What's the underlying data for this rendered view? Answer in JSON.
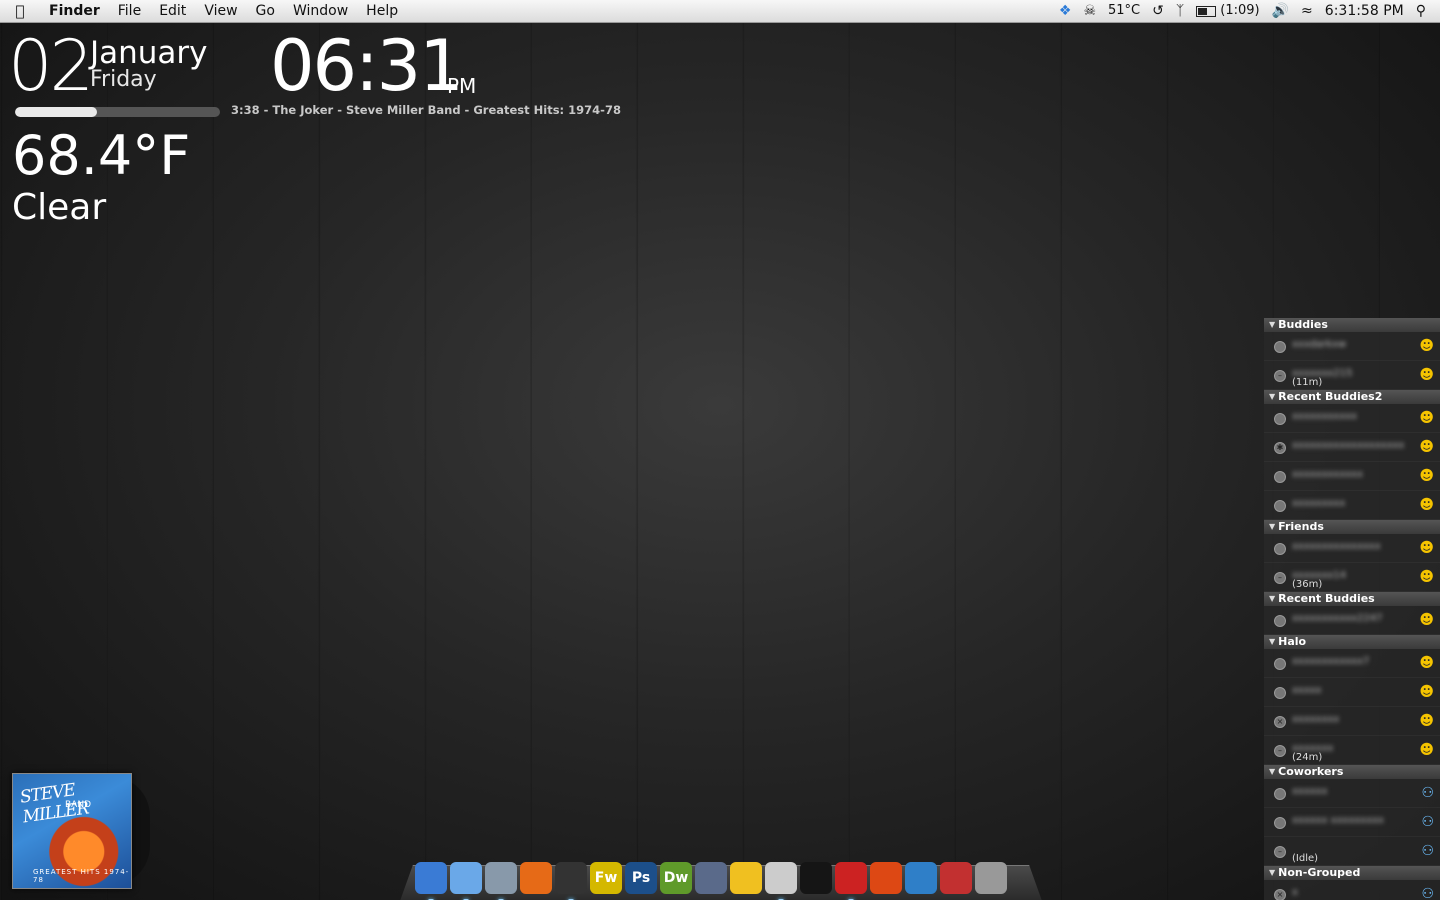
{
  "menubar": {
    "apple_icon": "apple-icon",
    "menus": [
      "Finder",
      "File",
      "Edit",
      "View",
      "Go",
      "Window",
      "Help"
    ],
    "status": {
      "temperature": "51°C",
      "battery": "(1:09)",
      "clock": "6:31:58 PM"
    }
  },
  "widgets": {
    "date_day": "02",
    "month": "January",
    "weekday": "Friday",
    "time": "06:31",
    "ampm": "PM",
    "track": "3:38 - The Joker - Steve Miller Band - Greatest Hits: 1974-78",
    "track_progress": 0.4,
    "temperature": "68.4°F",
    "condition": "Clear"
  },
  "album": {
    "title": "STEVE MILLER",
    "subtitle": "BAND",
    "bottom": "GREATEST HITS 1974-78"
  },
  "dock": {
    "apps": [
      {
        "icon": "finder-icon",
        "label": "",
        "color": "#3a7bd5",
        "running": true
      },
      {
        "icon": "itunes-icon",
        "label": "",
        "color": "#6aa8e8",
        "running": true
      },
      {
        "icon": "mail-icon",
        "label": "",
        "color": "#8899aa",
        "running": true
      },
      {
        "icon": "firefox-icon",
        "label": "",
        "color": "#e66a17",
        "running": false
      },
      {
        "icon": "adium-icon",
        "label": "",
        "color": "#333333",
        "running": true
      },
      {
        "icon": "fireworks-icon",
        "label": "Fw",
        "color": "#d4b800",
        "running": false
      },
      {
        "icon": "photoshop-icon",
        "label": "Ps",
        "color": "#1c4f8a",
        "running": false
      },
      {
        "icon": "dreamweaver-icon",
        "label": "Dw",
        "color": "#5f9a2a",
        "running": false
      },
      {
        "icon": "xcode-icon",
        "label": "",
        "color": "#5a6a8a",
        "running": false
      },
      {
        "icon": "cyberduck-icon",
        "label": "",
        "color": "#f0c020",
        "running": false
      },
      {
        "icon": "cd-icon",
        "label": "",
        "color": "#cccccc",
        "running": true
      },
      {
        "icon": "terminal-icon",
        "label": "",
        "color": "#151515",
        "running": false
      },
      {
        "icon": "parallels-icon",
        "label": "",
        "color": "#cc2222",
        "running": true
      },
      {
        "icon": "ubuntu-icon",
        "label": "",
        "color": "#dd4814",
        "running": false
      },
      {
        "icon": "windows-icon",
        "label": "",
        "color": "#2f7fc8",
        "running": false
      },
      {
        "icon": "app-store-icon",
        "label": "",
        "color": "#c23030",
        "running": false
      },
      {
        "icon": "trash-icon",
        "label": "",
        "color": "#999999",
        "running": false
      }
    ]
  },
  "buddy_list": {
    "groups": [
      {
        "name": "Buddies",
        "buddies": [
          {
            "name": "xxxdarkxw",
            "status": "away",
            "idle": "",
            "service": "aim"
          },
          {
            "name": "xxxxxxx215",
            "status": "idle",
            "idle": "(11m)",
            "service": "aim"
          }
        ]
      },
      {
        "name": "Recent Buddies2",
        "buddies": [
          {
            "name": "xxxxxxxxxxx",
            "status": "away",
            "idle": "",
            "service": "aim"
          },
          {
            "name": "xxxxxxxxxxxxxxxxxxx",
            "status": "mobile",
            "idle": "",
            "service": "aim"
          },
          {
            "name": "xxxxxxxxxxxx",
            "status": "away",
            "idle": "",
            "service": "aim"
          },
          {
            "name": "xxxxxxxxx",
            "status": "away",
            "idle": "",
            "service": "aim"
          }
        ]
      },
      {
        "name": "Friends",
        "buddies": [
          {
            "name": "xxxxxxxxxxxxxxx",
            "status": "away",
            "idle": "",
            "service": "aim"
          },
          {
            "name": "xxxxxxx14",
            "status": "idle",
            "idle": "(36m)",
            "service": "aim"
          }
        ]
      },
      {
        "name": "Recent Buddies",
        "buddies": [
          {
            "name": "xxxxxxxxxxx2247",
            "status": "away",
            "idle": "",
            "service": "aim"
          }
        ]
      },
      {
        "name": "Halo",
        "buddies": [
          {
            "name": "xxxxxxxxxxxx7",
            "status": "away",
            "idle": "",
            "service": "aim"
          },
          {
            "name": "xxxxx",
            "status": "away",
            "idle": "",
            "service": "aim"
          },
          {
            "name": "xxxxxxxx",
            "status": "offline",
            "idle": "",
            "service": "aim"
          },
          {
            "name": "xxxxxxx",
            "status": "idle",
            "idle": "(24m)",
            "service": "aim"
          }
        ]
      },
      {
        "name": "Coworkers",
        "buddies": [
          {
            "name": "xxxxxx",
            "status": "away",
            "idle": "",
            "service": "group"
          },
          {
            "name": "xxxxxx xxxxxxxxx",
            "status": "away",
            "idle": "",
            "service": "group"
          },
          {
            "name": "",
            "status": "idle",
            "idle": "(Idle)",
            "service": "group"
          }
        ]
      },
      {
        "name": "Non-Grouped",
        "buddies": [
          {
            "name": "x",
            "status": "offline",
            "idle": "",
            "service": "group"
          }
        ]
      }
    ]
  }
}
